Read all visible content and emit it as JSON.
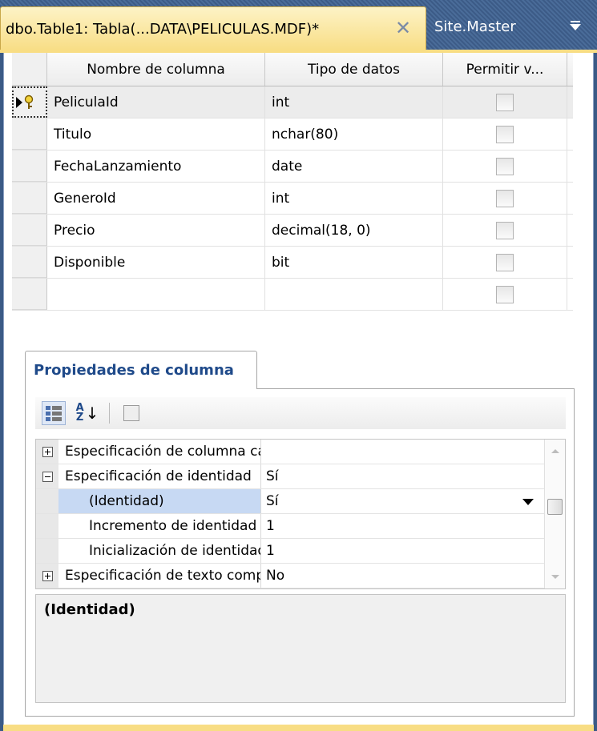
{
  "tabs": {
    "active_title": "dbo.Table1: Tabla(...DATA\\PELICULAS.MDF)*",
    "close_glyph": "✕",
    "inactive_title": "Site.Master"
  },
  "table": {
    "headers": [
      "Nombre de columna",
      "Tipo de datos",
      "Permitir v..."
    ],
    "rows": [
      {
        "name": "PeliculaId",
        "type": "int",
        "allow_nulls": false
      },
      {
        "name": "Titulo",
        "type": "nchar(80)",
        "allow_nulls": false
      },
      {
        "name": "FechaLanzamiento",
        "type": "date",
        "allow_nulls": false
      },
      {
        "name": "GeneroId",
        "type": "int",
        "allow_nulls": false
      },
      {
        "name": "Precio",
        "type": "decimal(18, 0)",
        "allow_nulls": false
      },
      {
        "name": "Disponible",
        "type": "bit",
        "allow_nulls": false
      },
      {
        "name": "",
        "type": "",
        "allow_nulls": false
      }
    ]
  },
  "properties": {
    "tab_label": "Propiedades de columna",
    "rows": [
      {
        "expander": "plus",
        "name": "Especificación de columna calculada",
        "value": ""
      },
      {
        "expander": "minus",
        "name": "Especificación de identidad",
        "value": "Sí"
      },
      {
        "expander": "",
        "name": "(Identidad)",
        "value": "Sí",
        "selected": true
      },
      {
        "expander": "",
        "name": "Incremento de identidad",
        "value": "1"
      },
      {
        "expander": "",
        "name": "Inicialización de identidad",
        "value": "1"
      },
      {
        "expander": "plus",
        "name": "Especificación de texto completo",
        "value": "No"
      }
    ],
    "description_title": "(Identidad)"
  },
  "colors": {
    "tab_active": "#f8dd84",
    "chrome": "#3b5a86",
    "selected_property": "#c7d9f3",
    "properties_tab_text": "#1f4a8a"
  }
}
